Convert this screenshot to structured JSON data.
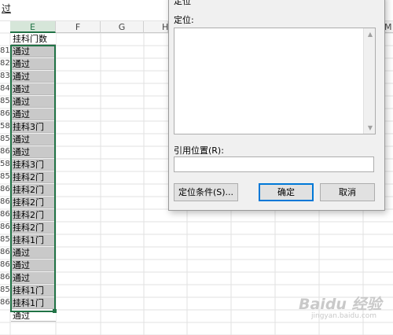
{
  "formula_bar": {
    "text": "过"
  },
  "columns": [
    "E",
    "F",
    "G",
    "H",
    "M"
  ],
  "sheet": {
    "header_cell": "挂科门数",
    "rows": [
      {
        "rownum": "81",
        "value": "通过"
      },
      {
        "rownum": "82",
        "value": "通过"
      },
      {
        "rownum": "83",
        "value": "通过"
      },
      {
        "rownum": "84",
        "value": "通过"
      },
      {
        "rownum": "85",
        "value": "通过"
      },
      {
        "rownum": "86",
        "value": "通过"
      },
      {
        "rownum": "58",
        "value": "挂科3门"
      },
      {
        "rownum": "85",
        "value": "通过"
      },
      {
        "rownum": "86",
        "value": "通过"
      },
      {
        "rownum": "58",
        "value": "挂科3门"
      },
      {
        "rownum": "85",
        "value": "挂科2门"
      },
      {
        "rownum": "86",
        "value": "挂科2门"
      },
      {
        "rownum": "86",
        "value": "挂科2门"
      },
      {
        "rownum": "86",
        "value": "挂科2门"
      },
      {
        "rownum": "86",
        "value": "挂科2门"
      },
      {
        "rownum": "85",
        "value": "挂科1门"
      },
      {
        "rownum": "86",
        "value": "通过"
      },
      {
        "rownum": "86",
        "value": "通过"
      },
      {
        "rownum": "86",
        "value": "通过"
      },
      {
        "rownum": "85",
        "value": "挂科1门"
      },
      {
        "rownum": "86",
        "value": "挂科1门"
      },
      {
        "rownum": "",
        "value": "通过"
      }
    ]
  },
  "dialog": {
    "title": "定位",
    "goto_label": "定位:",
    "reference_label": "引用位置(R):",
    "reference_value": "",
    "special_button": "定位条件(S)...",
    "ok_button": "确定",
    "cancel_button": "取消"
  },
  "watermark": {
    "text": "Baidu 经验",
    "sub": "jingyan.baidu.com"
  },
  "colors": {
    "selection_border": "#217346",
    "selected_fill": "#c9c9c9"
  }
}
